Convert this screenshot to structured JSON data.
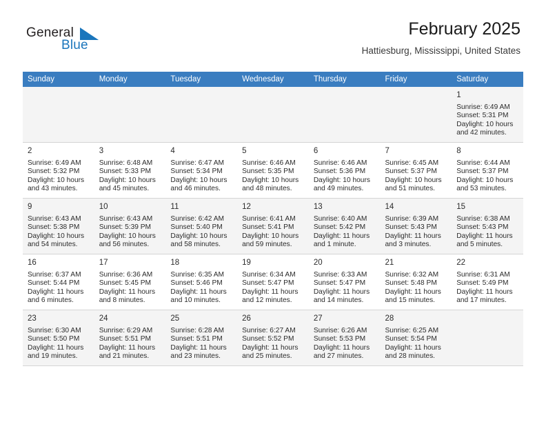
{
  "brand": {
    "name_part1": "General",
    "name_part2": "Blue",
    "mark": "triangle-logo",
    "accent_color": "#1b76bc"
  },
  "header": {
    "title": "February 2025",
    "location": "Hattiesburg, Mississippi, United States"
  },
  "calendar": {
    "header_bg": "#3a7dc0",
    "weekdays": [
      "Sunday",
      "Monday",
      "Tuesday",
      "Wednesday",
      "Thursday",
      "Friday",
      "Saturday"
    ],
    "weeks": [
      [
        {
          "day": "",
          "empty": true
        },
        {
          "day": "",
          "empty": true
        },
        {
          "day": "",
          "empty": true
        },
        {
          "day": "",
          "empty": true
        },
        {
          "day": "",
          "empty": true
        },
        {
          "day": "",
          "empty": true
        },
        {
          "day": "1",
          "sunrise": "Sunrise: 6:49 AM",
          "sunset": "Sunset: 5:31 PM",
          "daylight": "Daylight: 10 hours and 42 minutes."
        }
      ],
      [
        {
          "day": "2",
          "sunrise": "Sunrise: 6:49 AM",
          "sunset": "Sunset: 5:32 PM",
          "daylight": "Daylight: 10 hours and 43 minutes."
        },
        {
          "day": "3",
          "sunrise": "Sunrise: 6:48 AM",
          "sunset": "Sunset: 5:33 PM",
          "daylight": "Daylight: 10 hours and 45 minutes."
        },
        {
          "day": "4",
          "sunrise": "Sunrise: 6:47 AM",
          "sunset": "Sunset: 5:34 PM",
          "daylight": "Daylight: 10 hours and 46 minutes."
        },
        {
          "day": "5",
          "sunrise": "Sunrise: 6:46 AM",
          "sunset": "Sunset: 5:35 PM",
          "daylight": "Daylight: 10 hours and 48 minutes."
        },
        {
          "day": "6",
          "sunrise": "Sunrise: 6:46 AM",
          "sunset": "Sunset: 5:36 PM",
          "daylight": "Daylight: 10 hours and 49 minutes."
        },
        {
          "day": "7",
          "sunrise": "Sunrise: 6:45 AM",
          "sunset": "Sunset: 5:37 PM",
          "daylight": "Daylight: 10 hours and 51 minutes."
        },
        {
          "day": "8",
          "sunrise": "Sunrise: 6:44 AM",
          "sunset": "Sunset: 5:37 PM",
          "daylight": "Daylight: 10 hours and 53 minutes."
        }
      ],
      [
        {
          "day": "9",
          "sunrise": "Sunrise: 6:43 AM",
          "sunset": "Sunset: 5:38 PM",
          "daylight": "Daylight: 10 hours and 54 minutes."
        },
        {
          "day": "10",
          "sunrise": "Sunrise: 6:43 AM",
          "sunset": "Sunset: 5:39 PM",
          "daylight": "Daylight: 10 hours and 56 minutes."
        },
        {
          "day": "11",
          "sunrise": "Sunrise: 6:42 AM",
          "sunset": "Sunset: 5:40 PM",
          "daylight": "Daylight: 10 hours and 58 minutes."
        },
        {
          "day": "12",
          "sunrise": "Sunrise: 6:41 AM",
          "sunset": "Sunset: 5:41 PM",
          "daylight": "Daylight: 10 hours and 59 minutes."
        },
        {
          "day": "13",
          "sunrise": "Sunrise: 6:40 AM",
          "sunset": "Sunset: 5:42 PM",
          "daylight": "Daylight: 11 hours and 1 minute."
        },
        {
          "day": "14",
          "sunrise": "Sunrise: 6:39 AM",
          "sunset": "Sunset: 5:43 PM",
          "daylight": "Daylight: 11 hours and 3 minutes."
        },
        {
          "day": "15",
          "sunrise": "Sunrise: 6:38 AM",
          "sunset": "Sunset: 5:43 PM",
          "daylight": "Daylight: 11 hours and 5 minutes."
        }
      ],
      [
        {
          "day": "16",
          "sunrise": "Sunrise: 6:37 AM",
          "sunset": "Sunset: 5:44 PM",
          "daylight": "Daylight: 11 hours and 6 minutes."
        },
        {
          "day": "17",
          "sunrise": "Sunrise: 6:36 AM",
          "sunset": "Sunset: 5:45 PM",
          "daylight": "Daylight: 11 hours and 8 minutes."
        },
        {
          "day": "18",
          "sunrise": "Sunrise: 6:35 AM",
          "sunset": "Sunset: 5:46 PM",
          "daylight": "Daylight: 11 hours and 10 minutes."
        },
        {
          "day": "19",
          "sunrise": "Sunrise: 6:34 AM",
          "sunset": "Sunset: 5:47 PM",
          "daylight": "Daylight: 11 hours and 12 minutes."
        },
        {
          "day": "20",
          "sunrise": "Sunrise: 6:33 AM",
          "sunset": "Sunset: 5:47 PM",
          "daylight": "Daylight: 11 hours and 14 minutes."
        },
        {
          "day": "21",
          "sunrise": "Sunrise: 6:32 AM",
          "sunset": "Sunset: 5:48 PM",
          "daylight": "Daylight: 11 hours and 15 minutes."
        },
        {
          "day": "22",
          "sunrise": "Sunrise: 6:31 AM",
          "sunset": "Sunset: 5:49 PM",
          "daylight": "Daylight: 11 hours and 17 minutes."
        }
      ],
      [
        {
          "day": "23",
          "sunrise": "Sunrise: 6:30 AM",
          "sunset": "Sunset: 5:50 PM",
          "daylight": "Daylight: 11 hours and 19 minutes."
        },
        {
          "day": "24",
          "sunrise": "Sunrise: 6:29 AM",
          "sunset": "Sunset: 5:51 PM",
          "daylight": "Daylight: 11 hours and 21 minutes."
        },
        {
          "day": "25",
          "sunrise": "Sunrise: 6:28 AM",
          "sunset": "Sunset: 5:51 PM",
          "daylight": "Daylight: 11 hours and 23 minutes."
        },
        {
          "day": "26",
          "sunrise": "Sunrise: 6:27 AM",
          "sunset": "Sunset: 5:52 PM",
          "daylight": "Daylight: 11 hours and 25 minutes."
        },
        {
          "day": "27",
          "sunrise": "Sunrise: 6:26 AM",
          "sunset": "Sunset: 5:53 PM",
          "daylight": "Daylight: 11 hours and 27 minutes."
        },
        {
          "day": "28",
          "sunrise": "Sunrise: 6:25 AM",
          "sunset": "Sunset: 5:54 PM",
          "daylight": "Daylight: 11 hours and 28 minutes."
        },
        {
          "day": "",
          "empty": true
        }
      ]
    ]
  }
}
